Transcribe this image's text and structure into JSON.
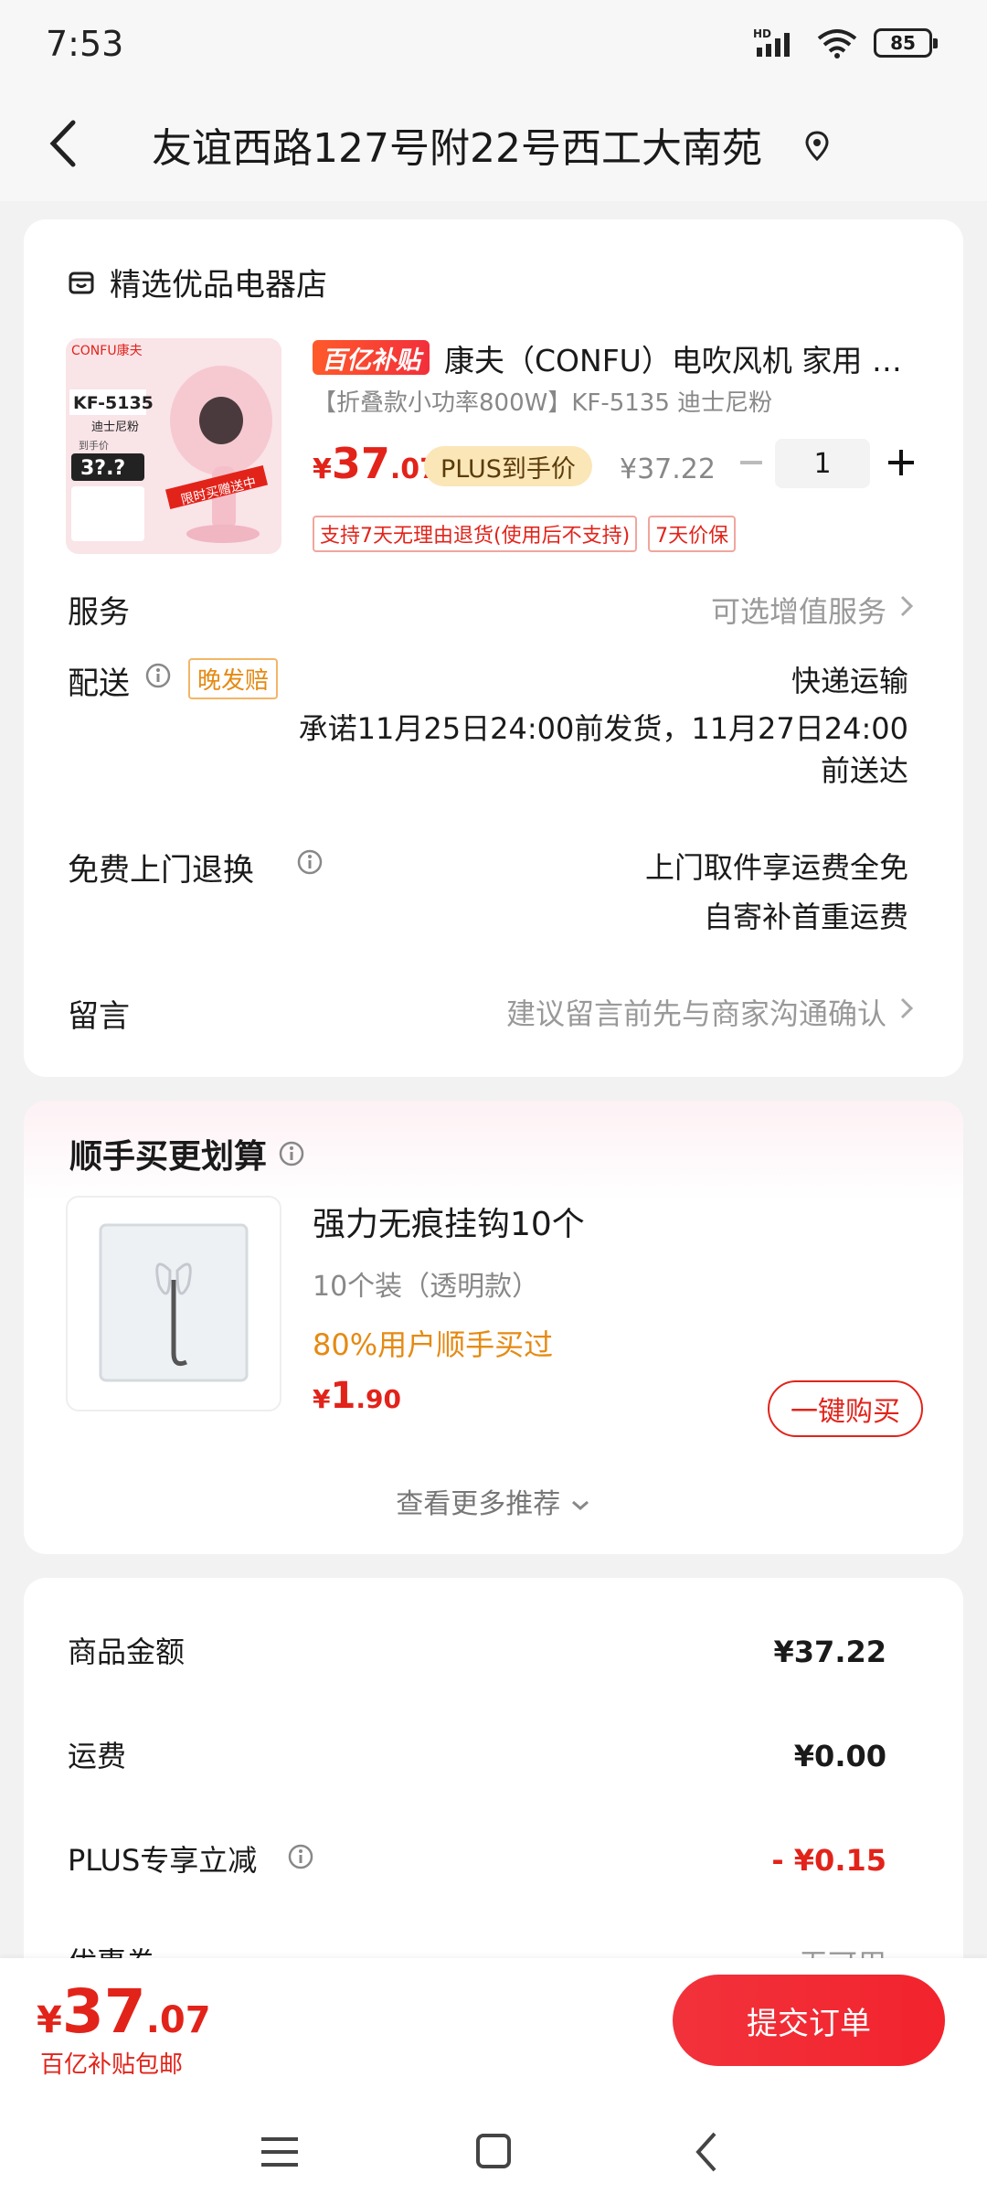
{
  "status": {
    "time": "7:53",
    "battery": "85",
    "network": "HD"
  },
  "header": {
    "address": "友谊西路127号附22号西工大南苑"
  },
  "shop": {
    "name": "精选优品电器店",
    "product": {
      "badge": "百亿补贴",
      "title": "康夫（CONFU）电吹风机 家用 …",
      "spec": "【折叠款小功率800W】KF-5135 迪士尼粉",
      "price_symbol": "¥",
      "price_int": "37",
      "price_dec": ".07",
      "plus_tag": "PLUS到手价",
      "orig_price": "¥37.22",
      "quantity": "1",
      "policies": [
        "支持7天无理由退货(使用后不支持)",
        "7天价保"
      ],
      "image_brand": "CONFU康夫",
      "image_model": "KF-5135",
      "image_color": "迪士尼粉",
      "image_price": "3?.?",
      "image_price_label": "到手价",
      "image_ribbon": "限时买赠送中"
    }
  },
  "rows": {
    "service_label": "服务",
    "service_value": "可选增值服务",
    "delivery_label": "配送",
    "delivery_tag": "晚发赔",
    "delivery_method": "快递运输",
    "delivery_promise_1": "承诺11月25日24:00前发货，11月27日24:00",
    "delivery_promise_2": "前送达",
    "return_label": "免费上门退换",
    "return_value_1": "上门取件享运费全免",
    "return_value_2": "自寄补首重运费",
    "message_label": "留言",
    "message_placeholder": "建议留言前先与商家沟通确认"
  },
  "recommend": {
    "title": "顺手买更划算",
    "item_name": "强力无痕挂钩10个",
    "item_spec": "10个装（透明款）",
    "item_bought": "80%用户顺手买过",
    "price_symbol": "¥",
    "price_int": "1",
    "price_dec": ".90",
    "buy_label": "一键购买",
    "more_label": "查看更多推荐"
  },
  "summary": {
    "goods_label": "商品金额",
    "goods_value": "¥37.22",
    "shipping_label": "运费",
    "shipping_value": "¥0.00",
    "plus_label": "PLUS专享立减",
    "plus_value": "- ¥0.15",
    "coupon_label": "优惠券",
    "coupon_value": "无可用"
  },
  "footer": {
    "price_symbol": "¥",
    "price_int": "37",
    "price_dec": ".07",
    "note": "百亿补贴包邮",
    "submit_label": "提交订单"
  },
  "colors": {
    "accent": "#e2231a",
    "plus_gold": "#fbe6b8",
    "orange": "#e58a13"
  }
}
